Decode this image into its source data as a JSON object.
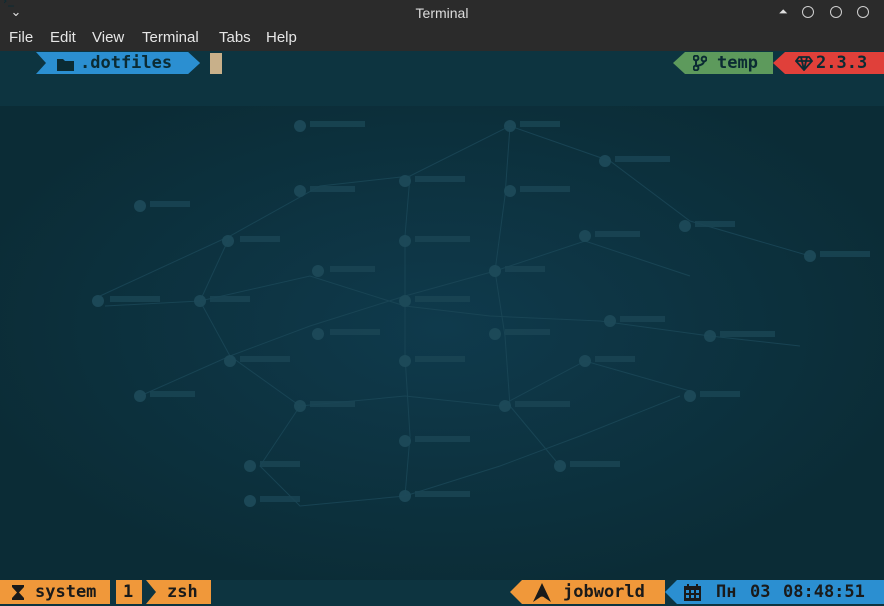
{
  "window": {
    "title": "Terminal"
  },
  "menu": [
    "File",
    "Edit",
    "View",
    "Terminal",
    "Tabs",
    "Help"
  ],
  "prompt": {
    "directory": ".dotfiles",
    "git_branch": "temp",
    "ruby_version": "2.3.3"
  },
  "status": {
    "session": "system",
    "window_index": "1",
    "shell": "zsh",
    "host": "jobworld",
    "day": "Пн",
    "date": "03",
    "time": "08:48:51"
  },
  "colors": {
    "blue": "#2b8fd1",
    "green": "#5d9a5c",
    "red": "#e0403a",
    "orange": "#f0983a",
    "background": "#0d3440"
  }
}
